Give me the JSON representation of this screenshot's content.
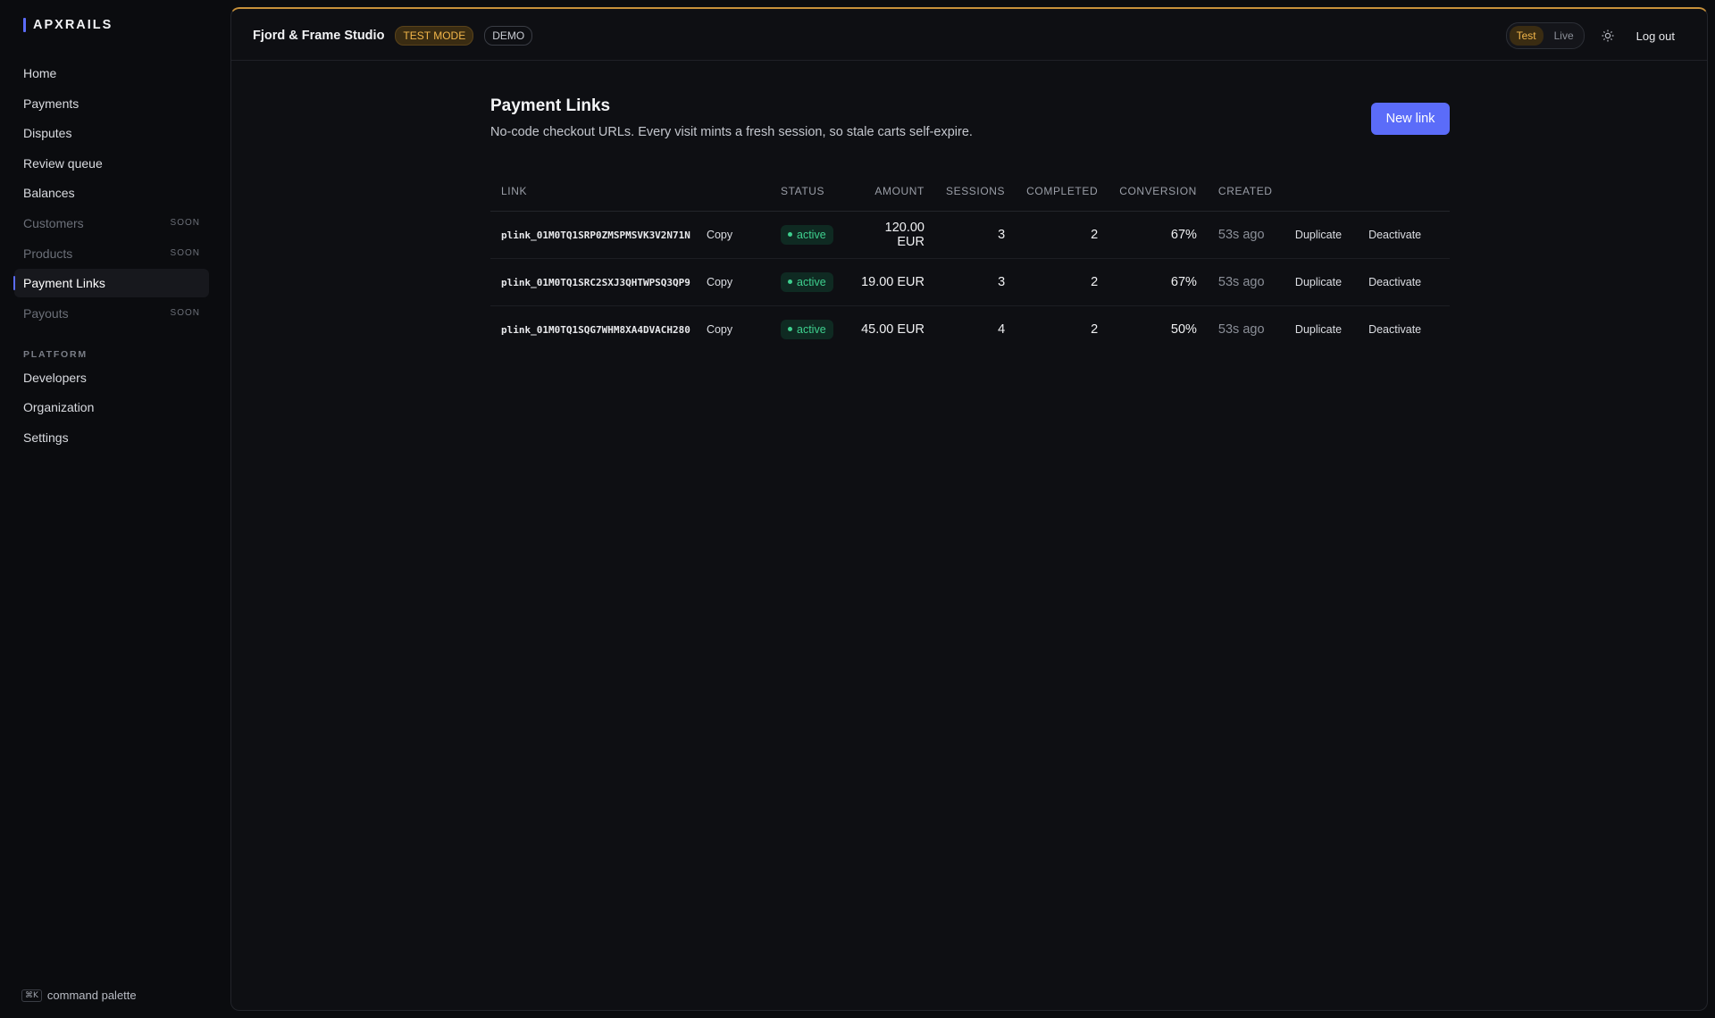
{
  "brand": "APXRAILS",
  "sidebar": {
    "items": [
      {
        "label": "Home",
        "soon": ""
      },
      {
        "label": "Payments",
        "soon": ""
      },
      {
        "label": "Disputes",
        "soon": ""
      },
      {
        "label": "Review queue",
        "soon": ""
      },
      {
        "label": "Balances",
        "soon": ""
      },
      {
        "label": "Customers",
        "soon": "SOON"
      },
      {
        "label": "Products",
        "soon": "SOON"
      },
      {
        "label": "Payment Links",
        "soon": ""
      },
      {
        "label": "Payouts",
        "soon": "SOON"
      }
    ],
    "section_platform": "PLATFORM",
    "platform_items": [
      {
        "label": "Developers"
      },
      {
        "label": "Organization"
      },
      {
        "label": "Settings"
      }
    ],
    "active": "Payment Links",
    "command_key": "⌘K",
    "command_label": "command palette"
  },
  "header": {
    "org_name": "Fjord & Frame Studio",
    "badge_test": "TEST MODE",
    "badge_demo": "DEMO",
    "mode_test": "Test",
    "mode_live": "Live",
    "mode_selected": "Test",
    "theme_icon": "sun-icon",
    "logout": "Log out"
  },
  "accent": {
    "primary": "#5b6cf9",
    "test_mode": "#f2b64a",
    "status_active": "#3ecf8e"
  },
  "page": {
    "title": "Payment Links",
    "subtitle": "No-code checkout URLs. Every visit mints a fresh session, so stale carts self-expire.",
    "new_button": "New link"
  },
  "table": {
    "columns": [
      "LINK",
      "STATUS",
      "AMOUNT",
      "SESSIONS",
      "COMPLETED",
      "CONVERSION",
      "CREATED"
    ],
    "rows": [
      {
        "id": "plink_01M0TQ1SRP0ZMSPMSVK3V2N71N",
        "copy": "Copy",
        "status": "active",
        "amount": "120.00 EUR",
        "sessions": "3",
        "completed": "2",
        "conversion": "67%",
        "created": "53s ago",
        "duplicate": "Duplicate",
        "deactivate": "Deactivate"
      },
      {
        "id": "plink_01M0TQ1SRC2SXJ3QHTWPSQ3QP9",
        "copy": "Copy",
        "status": "active",
        "amount": "19.00 EUR",
        "sessions": "3",
        "completed": "2",
        "conversion": "67%",
        "created": "53s ago",
        "duplicate": "Duplicate",
        "deactivate": "Deactivate"
      },
      {
        "id": "plink_01M0TQ1SQG7WHM8XA4DVACH280",
        "copy": "Copy",
        "status": "active",
        "amount": "45.00 EUR",
        "sessions": "4",
        "completed": "2",
        "conversion": "50%",
        "created": "53s ago",
        "duplicate": "Duplicate",
        "deactivate": "Deactivate"
      }
    ]
  }
}
